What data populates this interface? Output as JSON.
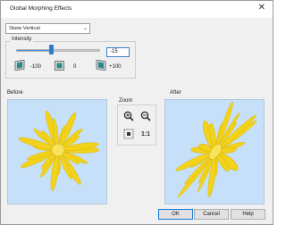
{
  "window": {
    "title": "Global Morphing Effects",
    "close_glyph": "✕"
  },
  "effect_select": {
    "value": "Skew Vertical"
  },
  "intensity": {
    "label": "Intensity",
    "value": "-15",
    "slider_fraction": 0.425,
    "min_label": "-100",
    "mid_label": "0",
    "max_label": "+100"
  },
  "icons": {
    "min": "skew-left-icon",
    "mid": "no-skew-icon",
    "max": "skew-right-icon",
    "zoom_in": "zoom-in-icon",
    "zoom_out": "zoom-out-icon",
    "fit": "zoom-fit-icon"
  },
  "before": {
    "label": "Before"
  },
  "after": {
    "label": "After"
  },
  "zoom": {
    "label": "Zoom",
    "actual_label": "1:1"
  },
  "buttons": {
    "ok": "OK",
    "cancel": "Cancel",
    "help": "Help"
  },
  "colors": {
    "preview_bg": "#c6e0fa",
    "petal": "#f2d21b",
    "accent": "#2d7fce"
  }
}
